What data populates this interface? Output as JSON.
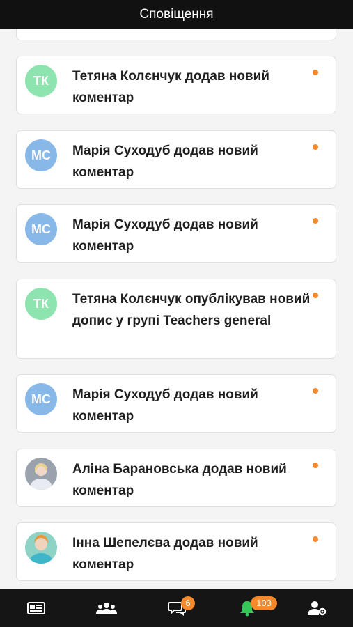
{
  "header": {
    "title": "Сповіщення"
  },
  "notifications": [
    {
      "initials": "ТК",
      "avatar": "tk",
      "text": "Тетяна Колєнчук додав новий коментар",
      "unread": true
    },
    {
      "initials": "МС",
      "avatar": "mc",
      "text": "Марія Суходуб додав новий коментар",
      "unread": true
    },
    {
      "initials": "МС",
      "avatar": "mc",
      "text": "Марія Суходуб додав новий коментар",
      "unread": true
    },
    {
      "initials": "ТК",
      "avatar": "tk",
      "text": "Тетяна Колєнчук опублікував новий допис у групі Teachers general",
      "unread": true
    },
    {
      "initials": "МС",
      "avatar": "mc",
      "text": "Марія Суходуб додав новий коментар",
      "unread": true
    },
    {
      "initials": "",
      "avatar": "photo",
      "text": "Аліна Барановська додав новий коментар",
      "unread": true
    },
    {
      "initials": "",
      "avatar": "photo",
      "text": "Інна Шепелєва додав новий коментар",
      "unread": true
    }
  ],
  "navbar": {
    "items": [
      {
        "icon": "news-feed-icon"
      },
      {
        "icon": "groups-icon"
      },
      {
        "icon": "chat-icon",
        "badge": "6"
      },
      {
        "icon": "bell-icon",
        "badge": "103"
      },
      {
        "icon": "user-settings-icon"
      }
    ]
  },
  "colors": {
    "unread_dot": "#f5892b",
    "avatar_tk": "#8ee4af",
    "avatar_mc": "#88b8e8",
    "header_bg": "#111111"
  }
}
